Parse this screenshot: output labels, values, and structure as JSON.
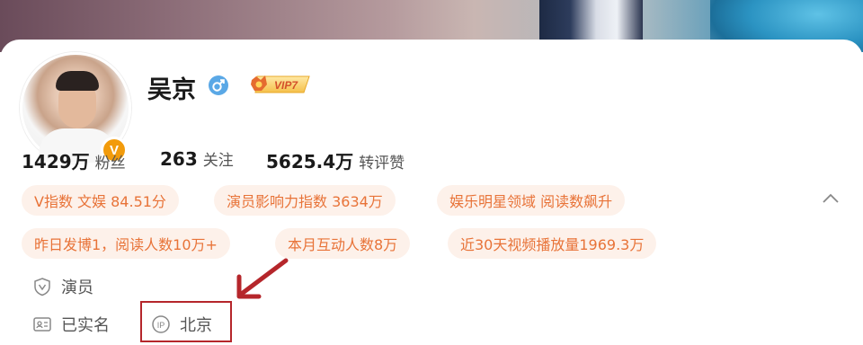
{
  "profile": {
    "name": "吴京",
    "vip_label": "VIP7",
    "verified_badge": "V",
    "gender": "male"
  },
  "stats": [
    {
      "value": "1429万",
      "label": "粉丝"
    },
    {
      "value": "263",
      "label": "关注"
    },
    {
      "value": "5625.4万",
      "label": "转评赞"
    }
  ],
  "tags_row1": [
    "V指数 文娱 84.51分",
    "演员影响力指数 3634万",
    "娱乐明星领域 阅读数飙升"
  ],
  "tags_row2": [
    "昨日发博1，阅读人数10万+",
    "本月互动人数8万",
    "近30天视频播放量1969.3万"
  ],
  "info": {
    "occupation": "演员",
    "verification": "已实名",
    "ip_location": "北京"
  },
  "colors": {
    "tag_bg": "#fdf1ea",
    "tag_text": "#e87338",
    "badge_orange": "#f29b0b",
    "highlight_red": "#b5262b",
    "gender_blue": "#5aa8e6"
  },
  "icons": {
    "gender": "male-symbol-icon",
    "collapse": "chevron-up-icon",
    "occupation": "shield-v-icon",
    "verification": "id-card-icon",
    "ip": "ip-location-icon"
  }
}
